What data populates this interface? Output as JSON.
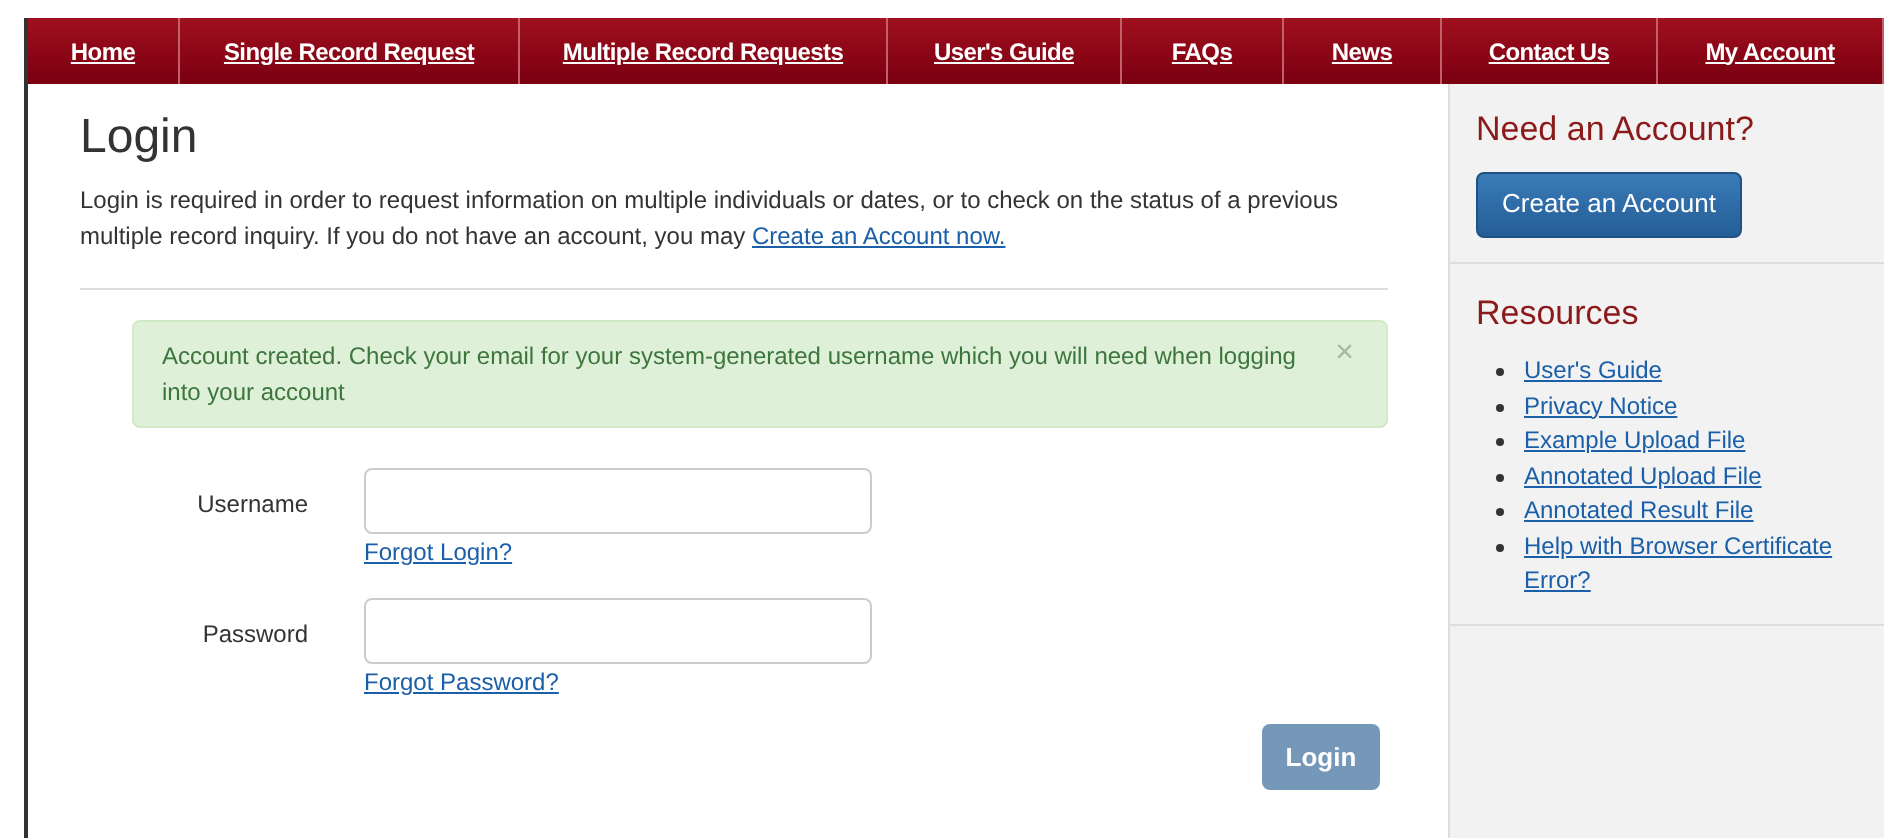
{
  "nav": [
    {
      "label": "Home"
    },
    {
      "label": "Single Record Request"
    },
    {
      "label": "Multiple Record Requests"
    },
    {
      "label": "User's Guide"
    },
    {
      "label": "FAQs"
    },
    {
      "label": "News"
    },
    {
      "label": "Contact Us"
    },
    {
      "label": "My Account"
    }
  ],
  "main": {
    "title": "Login",
    "intro": "Login is required in order to request information on multiple individuals or dates, or to check on the status of a previous multiple record inquiry. If you do not have an account, you may",
    "intro_link": "Create an Account now.",
    "alert": {
      "text": "Account created. Check your email for your system-generated username which you will need when logging into your account",
      "close": "×"
    },
    "fields": [
      {
        "label": "Username",
        "link": "Forgot Login?"
      },
      {
        "label": "Password",
        "link": "Forgot Password?"
      }
    ],
    "submit": {
      "label": "Login",
      "disabled": true
    }
  },
  "sidebar": {
    "account_title": "Need an Account?",
    "account_button": "Create an Account",
    "resources_title": "Resources",
    "resources": [
      {
        "label": "User's Guide"
      },
      {
        "label": "Privacy Notice"
      },
      {
        "label": "Example Upload File"
      },
      {
        "label": "Annotated Upload File"
      },
      {
        "label": "Annotated Result File"
      },
      {
        "label": "Help with Browser Certificate Error?"
      }
    ]
  }
}
